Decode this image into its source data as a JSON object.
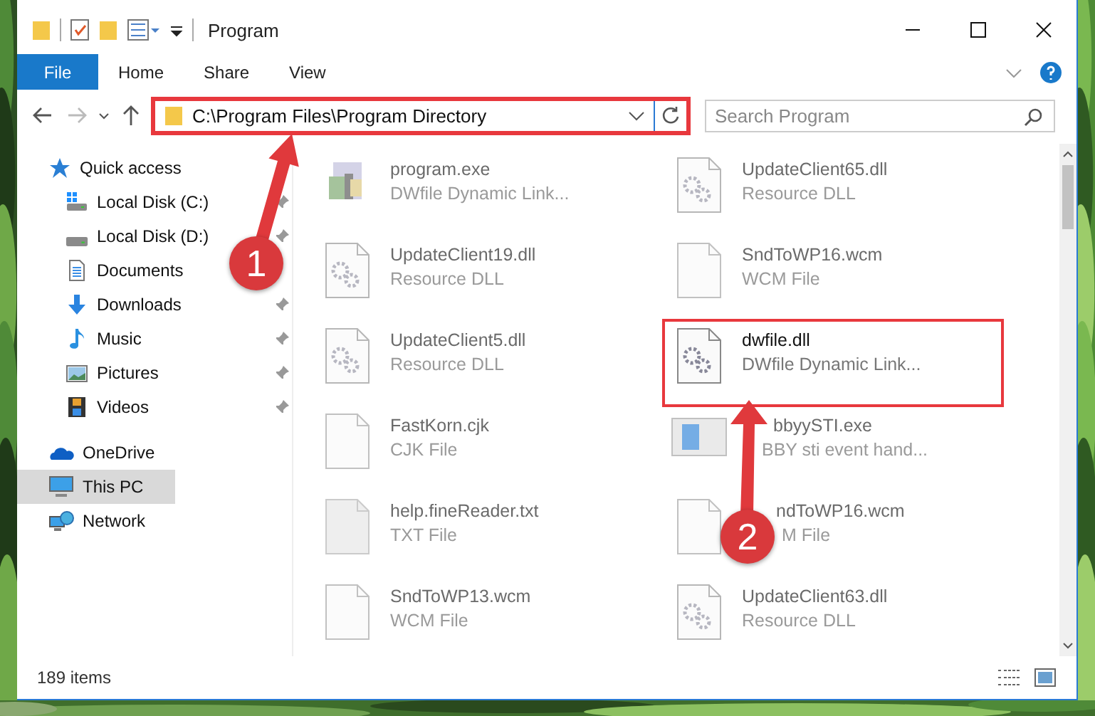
{
  "window": {
    "title": "Program"
  },
  "ribbon": {
    "tabs": [
      {
        "label": "File",
        "kind": "menu",
        "selected": false
      },
      {
        "label": "Home",
        "kind": "tab",
        "selected": false
      },
      {
        "label": "Share",
        "kind": "tab",
        "selected": false
      },
      {
        "label": "View",
        "kind": "tab",
        "selected": false
      }
    ]
  },
  "address": {
    "path": "C:\\Program Files\\Program Directory",
    "highlighted": true
  },
  "search": {
    "placeholder": "Search Program"
  },
  "nav": {
    "items": [
      {
        "label": "Quick access",
        "kind": "star",
        "selected": false,
        "children": [
          {
            "label": "Local Disk (C:)",
            "kind": "drive_windows",
            "pinned": true,
            "selected": false
          },
          {
            "label": "Local Disk (D:)",
            "kind": "drive",
            "pinned": true,
            "selected": false
          },
          {
            "label": "Documents",
            "kind": "documents",
            "pinned": false,
            "selected": false
          },
          {
            "label": "Downloads",
            "kind": "download",
            "pinned": true,
            "selected": false
          },
          {
            "label": "Music",
            "kind": "music",
            "pinned": true,
            "selected": false
          },
          {
            "label": "Pictures",
            "kind": "pictures",
            "pinned": true,
            "selected": false
          },
          {
            "label": "Videos",
            "kind": "videos",
            "pinned": true,
            "selected": false
          }
        ]
      },
      {
        "label": "OneDrive",
        "kind": "cloud",
        "selected": false
      },
      {
        "label": "This PC",
        "kind": "pc",
        "selected": true
      },
      {
        "label": "Network",
        "kind": "network",
        "selected": false
      }
    ]
  },
  "files": {
    "items": [
      {
        "name": "program.exe",
        "type": "DWfile Dynamic Link...",
        "kind": "app",
        "blurred": true,
        "highlighted": false
      },
      {
        "name": "UpdateClient65.dll",
        "type": "Resource DLL",
        "kind": "gear",
        "blurred": true,
        "highlighted": false
      },
      {
        "name": "UpdateClient19.dll",
        "type": "Resource DLL",
        "kind": "gear",
        "blurred": true,
        "highlighted": false
      },
      {
        "name": "SndToWP16.wcm",
        "type": "WCM File",
        "kind": "blank",
        "blurred": true,
        "highlighted": false
      },
      {
        "name": "UpdateClient5.dll",
        "type": "Resource DLL",
        "kind": "gear",
        "blurred": true,
        "highlighted": false
      },
      {
        "name": "dwfile.dll",
        "type": "DWfile Dynamic Link...",
        "kind": "gear",
        "blurred": false,
        "highlighted": true
      },
      {
        "name": "FastKorn.cjk",
        "type": "CJK File",
        "kind": "blank",
        "blurred": true,
        "highlighted": false
      },
      {
        "name": "bbyySTI.exe",
        "type": "BBY sti event hand...",
        "kind": "window",
        "blurred": true,
        "highlighted": false
      },
      {
        "name": "help.fineReader.txt",
        "type": "TXT File",
        "kind": "grey",
        "blurred": true,
        "highlighted": false
      },
      {
        "name": "ndToWP16.wcm",
        "type": "M File",
        "kind": "blank",
        "blurred": true,
        "highlighted": false
      },
      {
        "name": "SndToWP13.wcm",
        "type": "WCM File",
        "kind": "blank",
        "blurred": true,
        "highlighted": false
      },
      {
        "name": "UpdateClient63.dll",
        "type": "Resource DLL",
        "kind": "gear",
        "blurred": true,
        "highlighted": false
      }
    ]
  },
  "status_bar": {
    "count": "189 items"
  },
  "callouts": [
    {
      "number": "1"
    },
    {
      "number": "2"
    }
  ]
}
